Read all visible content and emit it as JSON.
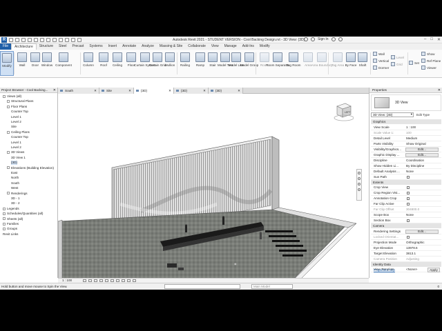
{
  "window": {
    "title": "Autodesk Revit 2021 - STUDENT VERSION - Cool Backing Design.rvt - 3D View: {3D}",
    "sign_in": "Sign In"
  },
  "ribbon_tabs": [
    "File",
    "Architecture",
    "Structure",
    "Steel",
    "Precast",
    "Systems",
    "Insert",
    "Annotate",
    "Analyze",
    "Massing & Site",
    "Collaborate",
    "View",
    "Manage",
    "Add-Ins",
    "Modify"
  ],
  "ribbon_buttons": [
    {
      "label": "Modify",
      "active": true
    },
    {
      "label": "Wall"
    },
    {
      "label": "Door"
    },
    {
      "label": "Window"
    },
    {
      "label": "Component"
    },
    {
      "label": "Column"
    },
    {
      "label": "Roof"
    },
    {
      "label": "Ceiling"
    },
    {
      "label": "Floor"
    },
    {
      "label": "Curtain System"
    },
    {
      "label": "Curtain Grid"
    },
    {
      "label": "Mullion"
    },
    {
      "label": "Railing"
    },
    {
      "label": "Ramp"
    },
    {
      "label": "Stair"
    },
    {
      "label": "Model Text"
    },
    {
      "label": "Model Line"
    },
    {
      "label": "Model Group"
    },
    {
      "label": "Room",
      "dim": true
    },
    {
      "label": "Room Separator"
    },
    {
      "label": "Tag Room"
    },
    {
      "label": "Area",
      "dim": true
    },
    {
      "label": "Area Boundary",
      "dim": true
    },
    {
      "label": "Tag Area",
      "dim": true
    },
    {
      "label": "By Face"
    },
    {
      "label": "Shaft"
    }
  ],
  "ribbon_small": {
    "wall": "Wall",
    "vertical": "Vertical",
    "dormer": "Dormer",
    "level": "Level",
    "grid": "Grid",
    "set": "Set",
    "show": "Show",
    "ref_plane": "Ref Plane",
    "viewer": "Viewer"
  },
  "project_browser": {
    "title": "Project Browser - Cool Backing...",
    "items": [
      "Views (all)",
      "Structural Plans",
      "Floor Plans",
      "Counter Top",
      "Level 1",
      "Level 2",
      "Site",
      "Ceiling Plans",
      "Counter Top",
      "Level 1",
      "Level 2",
      "3D Views",
      "3D View 1",
      "{3D}",
      "Elevations (Building Elevation)",
      "East",
      "North",
      "South",
      "West",
      "Renderings",
      "3D - 1",
      "3D - 2",
      "Legends",
      "Schedules/Quantities (all)",
      "Sheets (all)",
      "Families",
      "Groups",
      "Revit Links"
    ]
  },
  "view_tabs": [
    "South",
    "Site",
    "{3D}",
    "{3D}",
    "{3D}"
  ],
  "viewcube": {
    "face": "LEFT"
  },
  "properties": {
    "title": "Properties",
    "type_name": "3D View",
    "instance_selector": "3D View: {3D}",
    "edit_type": "Edit Type",
    "sections": {
      "graphics": "Graphics",
      "extents": "Extents",
      "camera": "Camera",
      "identity": "Identity Data"
    },
    "graphics_rows": [
      {
        "k": "View Scale",
        "v": "1 : 100"
      },
      {
        "k": "Scale Value 1:",
        "v": "100",
        "dim": true
      },
      {
        "k": "Detail Level",
        "v": "Medium"
      },
      {
        "k": "Parts Visibility",
        "v": "Show Original"
      },
      {
        "k": "Visibility/Graphics...",
        "v": "Edit...",
        "btn": true
      },
      {
        "k": "Graphic Display ...",
        "v": "Edit...",
        "btn": true
      },
      {
        "k": "Discipline",
        "v": "Coordination"
      },
      {
        "k": "Show Hidden Li...",
        "v": "By Discipline"
      },
      {
        "k": "Default Analysis ...",
        "v": "None"
      },
      {
        "k": "Sun Path",
        "v": ""
      }
    ],
    "extents_rows": [
      {
        "k": "Crop View",
        "v": ""
      },
      {
        "k": "Crop Region Visi...",
        "v": ""
      },
      {
        "k": "Annotation Crop",
        "v": ""
      },
      {
        "k": "Far Clip Active",
        "v": ""
      },
      {
        "k": "Far Clip Offset",
        "v": "304800.0",
        "dim": true
      },
      {
        "k": "Scope Box",
        "v": "None"
      },
      {
        "k": "Section Box",
        "v": ""
      }
    ],
    "camera_rows": [
      {
        "k": "Rendering Settings",
        "v": "Edit...",
        "btn": true
      },
      {
        "k": "Locked Orientat...",
        "v": "",
        "dim": true
      },
      {
        "k": "Projection Mode",
        "v": "Orthographic"
      },
      {
        "k": "Eye Elevation",
        "v": "13978.6"
      },
      {
        "k": "Target Elevation",
        "v": "3813.1"
      },
      {
        "k": "Camera Position",
        "v": "Adjusting",
        "dim": true
      }
    ],
    "identity_rows": [
      {
        "k": "View Template",
        "v": "<None>"
      }
    ],
    "help_link": "Properties help",
    "apply": "Apply"
  },
  "view_control": {
    "scale": "1 : 100"
  },
  "status": {
    "message": "Hold button and move mouse to Spin the View.",
    "main_model": "Main Model",
    "filter": "0"
  }
}
